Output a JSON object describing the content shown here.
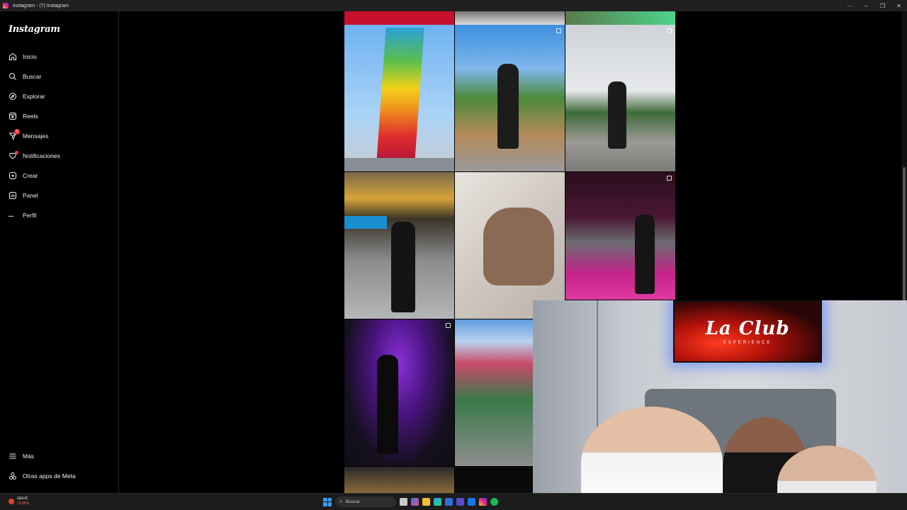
{
  "window": {
    "title": "Instagram - (7) Instagram"
  },
  "sidebar": {
    "logo": "Instagram",
    "items": [
      {
        "label": "Inicio",
        "icon": "home-icon"
      },
      {
        "label": "Buscar",
        "icon": "search-icon"
      },
      {
        "label": "Explorar",
        "icon": "compass-icon"
      },
      {
        "label": "Reels",
        "icon": "reels-icon"
      },
      {
        "label": "Mensajes",
        "icon": "messenger-icon",
        "badge": "2"
      },
      {
        "label": "Notificaciones",
        "icon": "heart-icon"
      },
      {
        "label": "Crear",
        "icon": "plus-square-icon"
      },
      {
        "label": "Panel",
        "icon": "dashboard-icon"
      },
      {
        "label": "Perfil",
        "icon": "avatar"
      }
    ],
    "bottom": [
      {
        "label": "Más",
        "icon": "menu-icon"
      },
      {
        "label": "Otras apps de Meta",
        "icon": "meta-apps-icon"
      }
    ]
  },
  "webcam": {
    "tv_title": "La Club",
    "tv_subtitle": "EXPERIENCE"
  },
  "taskbar": {
    "weather_label": "GEHC",
    "weather_change": "-3,06%",
    "search_placeholder": "Buscar"
  },
  "colors": {
    "background": "#000000",
    "badge": "#ff3040",
    "accent": "#0095f6"
  }
}
